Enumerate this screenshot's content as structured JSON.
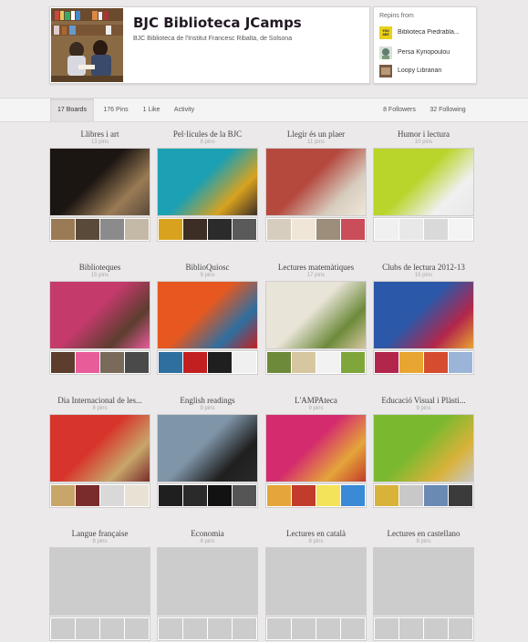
{
  "profile": {
    "name": "BJC Biblioteca JCamps",
    "about": "BJC Biblioteca de l'Institut Francesc Ribalta, de Solsona"
  },
  "repins": {
    "title": "Repins from",
    "items": [
      {
        "label": "Biblioteca Piedrabla...",
        "color": "#e9d11a"
      },
      {
        "label": "Persa Kyriopoulou",
        "color": "#5f7e6f"
      },
      {
        "label": "Loopy Librarian",
        "color": "#7a5a45"
      }
    ]
  },
  "tabs": {
    "boards": "17 Boards",
    "pins": "176 Pins",
    "likes": "1 Like",
    "activity": "Activity",
    "followers": "8 Followers",
    "following": "32 Following"
  },
  "boards": [
    {
      "title": "Llibres i art",
      "pins": "13 pins",
      "colors": [
        "#1c1612",
        "#9a7b55",
        "#5a4a3a",
        "#8b8b8b",
        "#c4b9a6"
      ]
    },
    {
      "title": "Pel·lícules de la BJC",
      "pins": "8 pins",
      "colors": [
        "#1ba0b4",
        "#d8a21f",
        "#3c2d25",
        "#2b2b2b",
        "#5a5a5a"
      ]
    },
    {
      "title": "Llegir és un plaer",
      "pins": "11 pins",
      "colors": [
        "#b5493e",
        "#d7cdbf",
        "#efe6d8",
        "#9c8e7a",
        "#c94d5a"
      ]
    },
    {
      "title": "Humor i lectura",
      "pins": "10 pins",
      "colors": [
        "#b9d42a",
        "#f0f0f0",
        "#e8e8e8",
        "#d9d9d9",
        "#f4f4f4"
      ]
    },
    {
      "title": "Biblioteques",
      "pins": "15 pins",
      "colors": [
        "#c33a6b",
        "#5c3d2e",
        "#e85c9a",
        "#7a6a5a",
        "#4a4a4a"
      ]
    },
    {
      "title": "BiblioQuiosc",
      "pins": "9 pins",
      "colors": [
        "#e6581f",
        "#2e6fa0",
        "#c22020",
        "#1f1f1f",
        "#f0f0f0"
      ]
    },
    {
      "title": "Lectures matemàtiques",
      "pins": "17 pins",
      "colors": [
        "#e9e4d8",
        "#6d8a3a",
        "#d6c7a0",
        "#f2f2f2",
        "#7fa63a"
      ]
    },
    {
      "title": "Clubs de lectura 2012-13",
      "pins": "15 pins",
      "colors": [
        "#2b58a8",
        "#b3264b",
        "#e8a531",
        "#d64c2f",
        "#9bb5d8"
      ]
    },
    {
      "title": "Dia Internacional de les...",
      "pins": "8 pins",
      "colors": [
        "#d7342b",
        "#c8a66a",
        "#7a2c2c",
        "#d9d9d9",
        "#e8e2d4"
      ]
    },
    {
      "title": "English readings",
      "pins": "9 pins",
      "colors": [
        "#7f95a8",
        "#1f1f1f",
        "#2a2a2a",
        "#121212",
        "#555555"
      ]
    },
    {
      "title": "L'AMPAteca",
      "pins": "9 pins",
      "colors": [
        "#d42a6e",
        "#e5a53a",
        "#c23b2b",
        "#f3e35a",
        "#3a8ad6"
      ]
    },
    {
      "title": "Educació Visual i Plàsti...",
      "pins": "9 pins",
      "colors": [
        "#7ab92f",
        "#d9b23a",
        "#c8c8c8",
        "#6a8ab4",
        "#3b3b3b"
      ]
    },
    {
      "title": "Langue française",
      "pins": "8 pins",
      "colors": [
        "#cccccc",
        "#cccccc",
        "#cccccc",
        "#cccccc",
        "#cccccc"
      ]
    },
    {
      "title": "Economia",
      "pins": "8 pins",
      "colors": [
        "#cccccc",
        "#cccccc",
        "#cccccc",
        "#cccccc",
        "#cccccc"
      ]
    },
    {
      "title": "Lectures en català",
      "pins": "8 pins",
      "colors": [
        "#cccccc",
        "#cccccc",
        "#cccccc",
        "#cccccc",
        "#cccccc"
      ]
    },
    {
      "title": "Lectures en castellano",
      "pins": "8 pins",
      "colors": [
        "#cccccc",
        "#cccccc",
        "#cccccc",
        "#cccccc",
        "#cccccc"
      ]
    }
  ]
}
